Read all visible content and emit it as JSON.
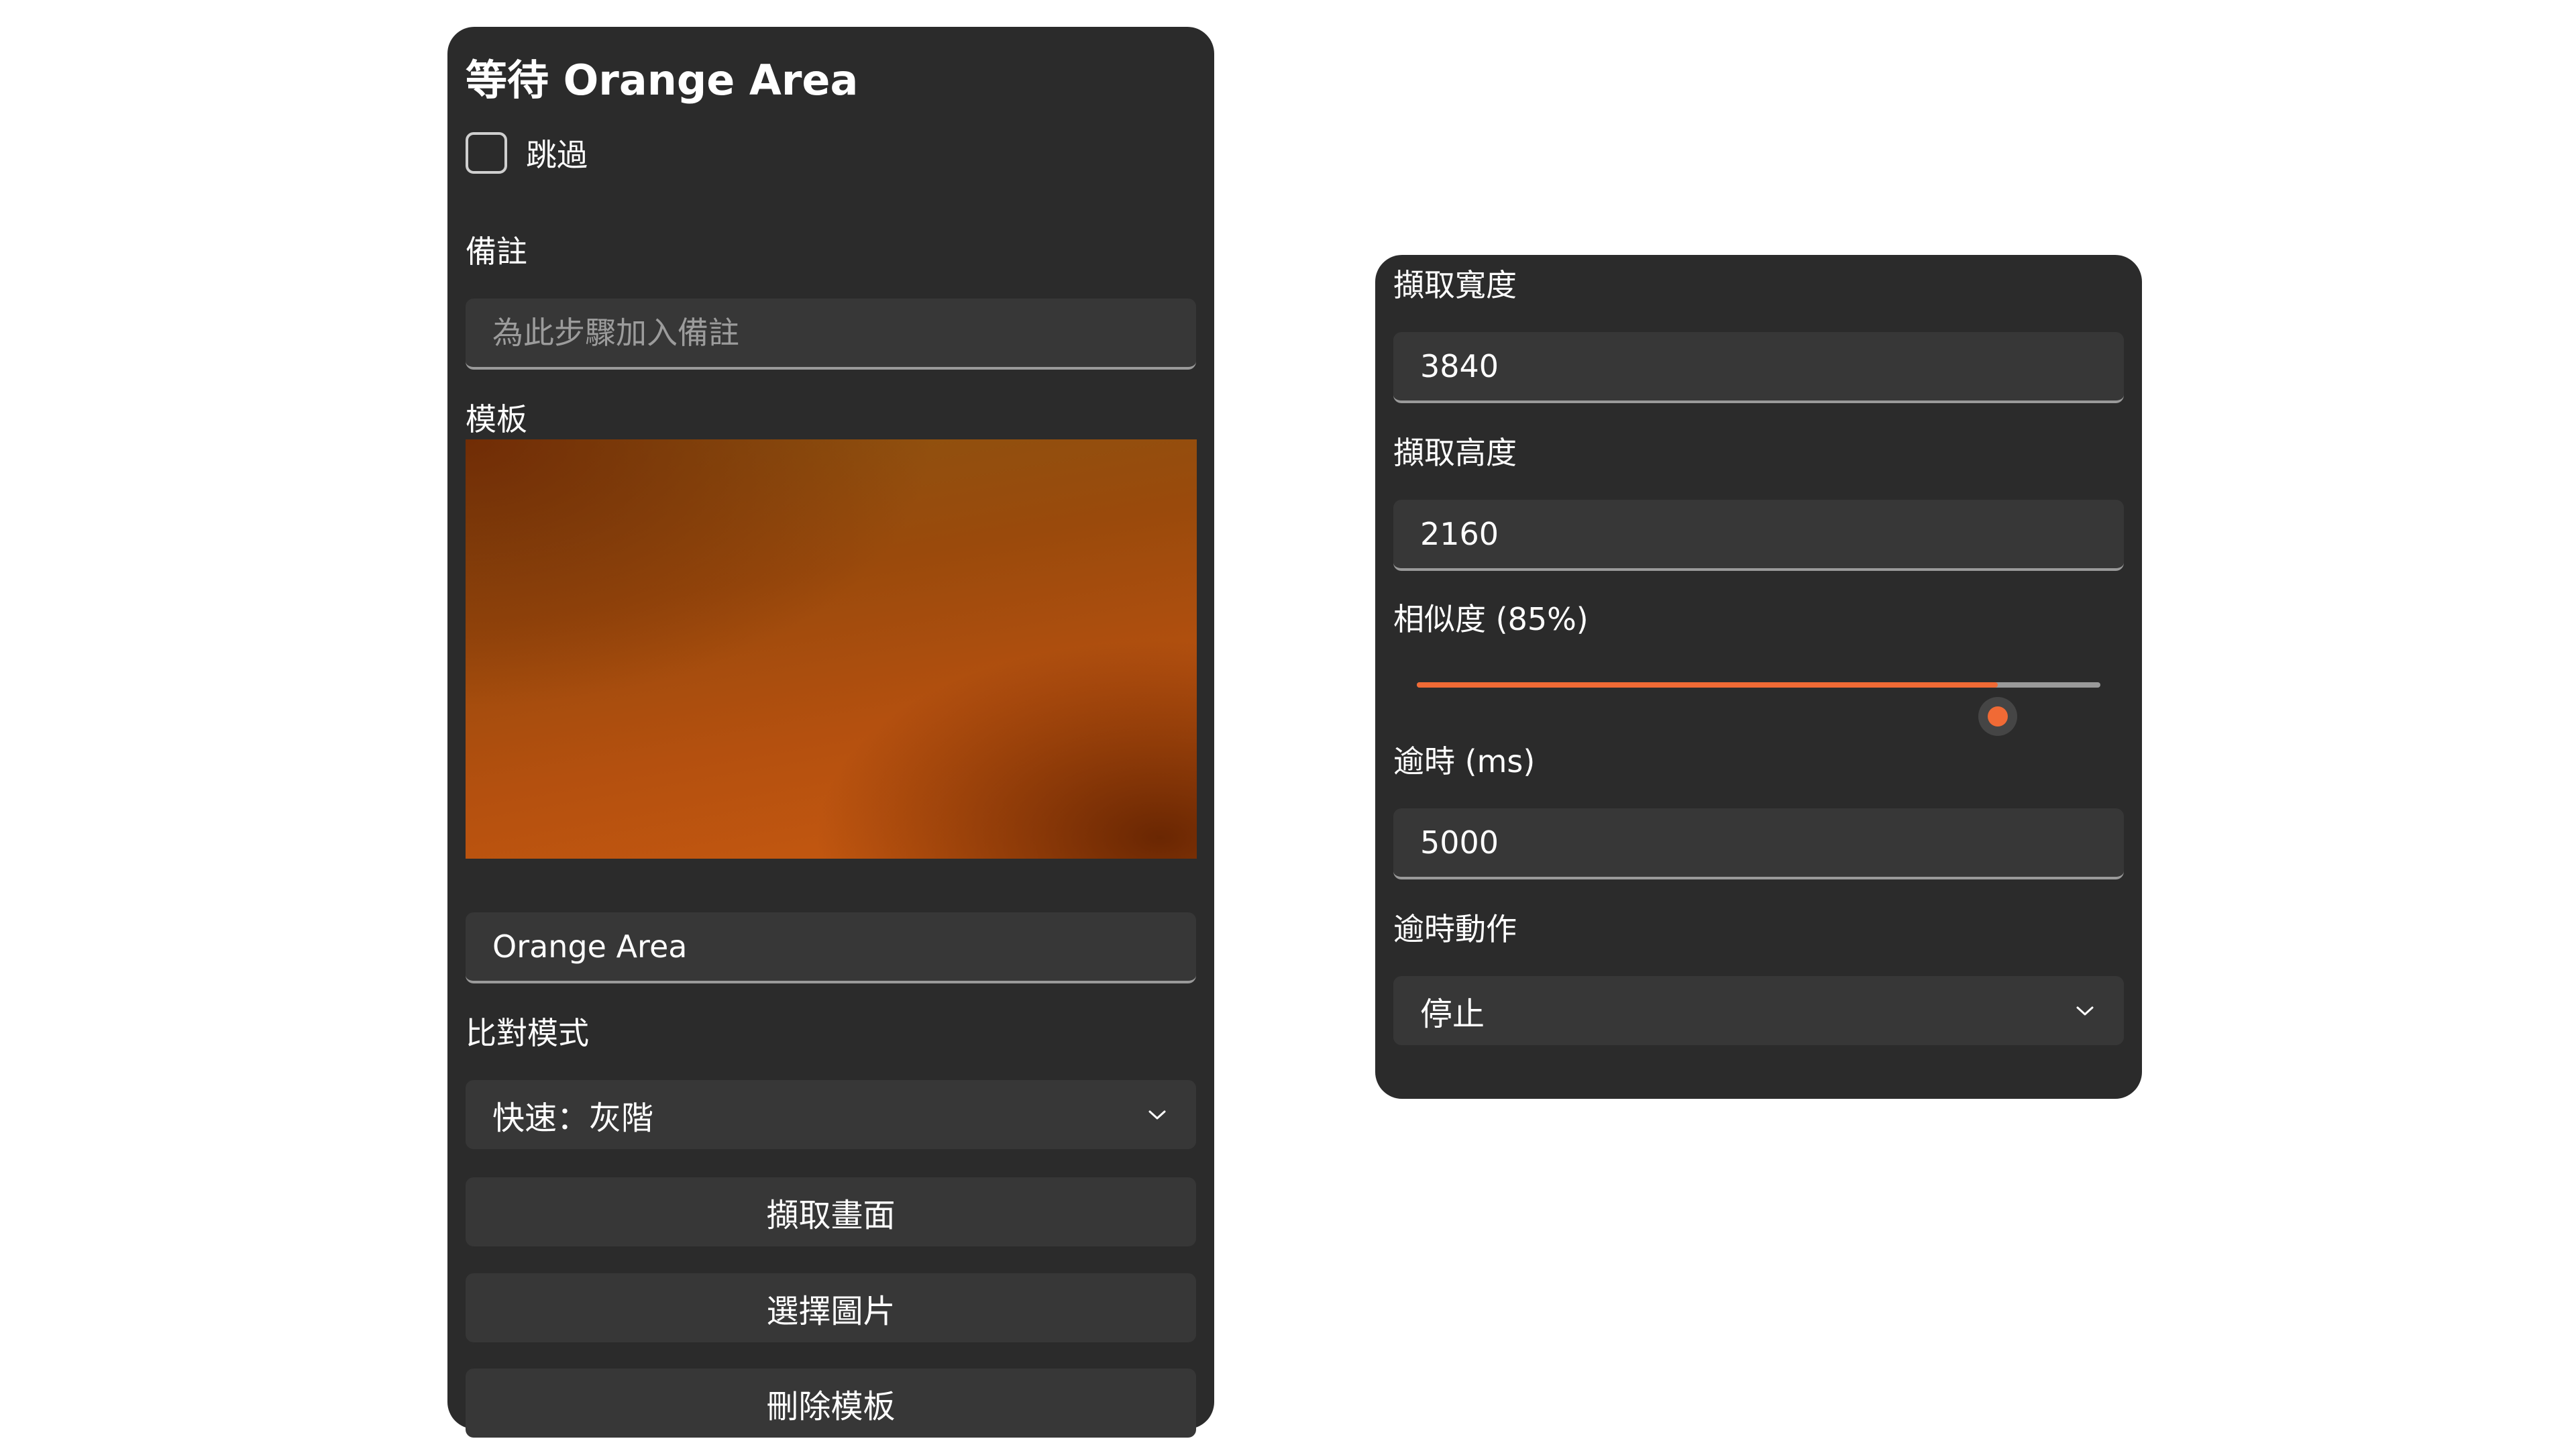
{
  "left_panel": {
    "title": "等待 Orange Area",
    "skip": {
      "label": "跳過",
      "checked": false
    },
    "note": {
      "label": "備註",
      "placeholder": "為此步驟加入備註",
      "value": ""
    },
    "template": {
      "label": "模板",
      "name_value": "Orange Area"
    },
    "compare_mode": {
      "label": "比對模式",
      "selected": "快速：灰階"
    },
    "buttons": {
      "capture": "擷取畫面",
      "choose_image": "選擇圖片",
      "delete_template": "刪除模板"
    }
  },
  "right_panel": {
    "capture_width": {
      "label": "擷取寬度",
      "value": "3840"
    },
    "capture_height": {
      "label": "擷取高度",
      "value": "2160"
    },
    "similarity": {
      "label": "相似度 (85%)",
      "value": 0.85
    },
    "timeout": {
      "label": "逾時 (ms)",
      "value": "5000"
    },
    "timeout_action": {
      "label": "逾時動作",
      "selected": "停止"
    }
  },
  "colors": {
    "panel_bg": "#2b2b2b",
    "field_bg": "#373737",
    "accent": "#f06a35"
  }
}
